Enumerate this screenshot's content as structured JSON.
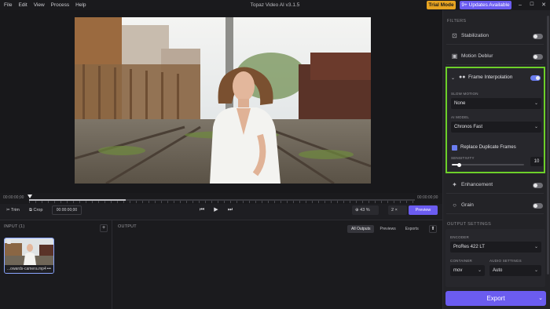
{
  "titlebar": {
    "menu": [
      "File",
      "Edit",
      "View",
      "Process",
      "Help"
    ],
    "app_title": "Topaz Video AI  v3.1.5",
    "trial_label": "Trial Mode",
    "updates_label": "9+ Updates Available",
    "window_controls": {
      "minimize": "–",
      "maximize": "☐",
      "close": "✕"
    }
  },
  "timeline": {
    "start_time": "00:00:00;00",
    "end_time": "00:00:00;00",
    "progress_fraction": 0.25
  },
  "controls": {
    "trim_label": "Trim",
    "crop_label": "Crop",
    "timecode": "00:00:00;00",
    "zoom_value": "43 %",
    "speed_value": "2 ×",
    "preview_label": "Preview",
    "icons": {
      "prev": "prev-frame-icon",
      "play": "play-icon",
      "next": "next-frame-icon"
    }
  },
  "input_panel": {
    "title": "INPUT (1)",
    "add_label": "+",
    "thumb_label": "...owards-camera.mp4",
    "thumb_more": "•••"
  },
  "output_panel": {
    "title": "OUTPUT",
    "tabs": [
      "All Outputs",
      "Previews",
      "Exports"
    ],
    "active_tab": "All Outputs"
  },
  "sidebar": {
    "filters_title": "FILTERS",
    "filters": [
      {
        "label": "Stabilization",
        "enabled": false,
        "icon": "stabilization-icon"
      },
      {
        "label": "Motion Deblur",
        "enabled": false,
        "icon": "deblur-icon"
      },
      {
        "label": "Frame Interpolation",
        "enabled": true,
        "icon": "interpolation-icon"
      },
      {
        "label": "Enhancement",
        "enabled": false,
        "icon": "sparkle-icon"
      },
      {
        "label": "Grain",
        "enabled": false,
        "icon": "grain-icon"
      }
    ],
    "frame_interpolation": {
      "slow_motion_label": "SLOW MOTION",
      "slow_motion_value": "None",
      "ai_model_label": "AI MODEL",
      "ai_model_value": "Chronos Fast",
      "replace_duplicates_label": "Replace Duplicate Frames",
      "replace_duplicates_checked": true,
      "sensitivity_label": "SENSITIVITY",
      "sensitivity_value": "10",
      "sensitivity_fraction": 0.1
    },
    "output_settings_title": "OUTPUT SETTINGS",
    "encoder_label": "ENCODER",
    "encoder_value": "ProRes 422 LT",
    "container_label": "CONTAINER",
    "container_value": "mov",
    "audio_label": "AUDIO SETTINGS",
    "audio_value": "Auto",
    "export_label": "Export"
  },
  "colors": {
    "accent": "#6b5cf0",
    "trial": "#e7a321",
    "highlight": "#6dd02a",
    "toggle_on": "#6b7df0"
  }
}
